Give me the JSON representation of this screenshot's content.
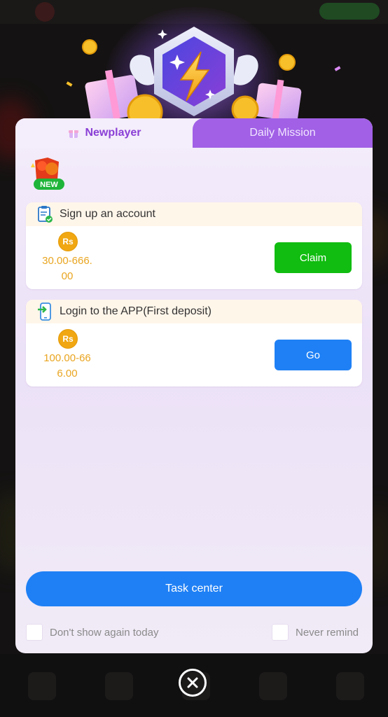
{
  "tabs": {
    "newplayer": "Newplayer",
    "daily_mission": "Daily Mission"
  },
  "new_badge": "NEW",
  "tasks": [
    {
      "title": "Sign up an account",
      "currency": "Rs",
      "amount_line1": "30.00-666.",
      "amount_line2": "00",
      "button": "Claim",
      "icon": "clipboard-check-icon"
    },
    {
      "title": "Login to the APP(First deposit)",
      "currency": "Rs",
      "amount_line1": "100.00-66",
      "amount_line2": "6.00",
      "button": "Go",
      "icon": "phone-login-icon"
    }
  ],
  "task_center_label": "Task center",
  "options": {
    "dont_show_today": "Don't show again today",
    "never_remind": "Never remind"
  },
  "colors": {
    "accent_purple": "#a160e6",
    "claim_green": "#10bd10",
    "primary_blue": "#1f80f5",
    "coin_gold": "#f0a712"
  }
}
